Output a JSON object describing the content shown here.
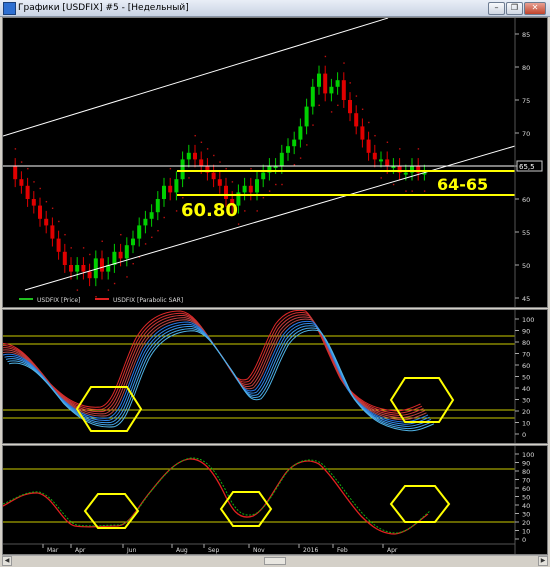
{
  "window": {
    "title": "Графики [USDFIX] #5 - [Недельный]",
    "buttons": {
      "minimize": "–",
      "restore": "❐",
      "close": "✕"
    }
  },
  "price_panel": {
    "y_ticks": [
      "85",
      "80",
      "75",
      "70",
      "65",
      "60",
      "55",
      "50",
      "45"
    ],
    "last_price_label": "65,5",
    "legend": [
      {
        "label": "USDFIX [Price]",
        "color": "#1fbf1f"
      },
      {
        "label": "USDFIX [Parabolic SAR]",
        "color": "#e02020"
      }
    ],
    "annotations": {
      "level_high": "64-65",
      "level_low": "60.80"
    }
  },
  "oscillator_panel": {
    "y_ticks": [
      "100",
      "90",
      "80",
      "70",
      "60",
      "50",
      "40",
      "30",
      "20",
      "10",
      "0"
    ]
  },
  "stochastic_panel": {
    "y_ticks": [
      "100",
      "90",
      "80",
      "70",
      "60",
      "50",
      "40",
      "30",
      "20",
      "10",
      "0"
    ]
  },
  "time_axis": {
    "labels": [
      "Mar",
      "Apr",
      "Jun",
      "Aug",
      "Sep",
      "Nov",
      "2016",
      "Feb",
      "Apr"
    ]
  },
  "colors": {
    "bull": "#00d000",
    "bear": "#e00000",
    "highlight": "#ffff00",
    "channel": "#ffffff"
  }
}
